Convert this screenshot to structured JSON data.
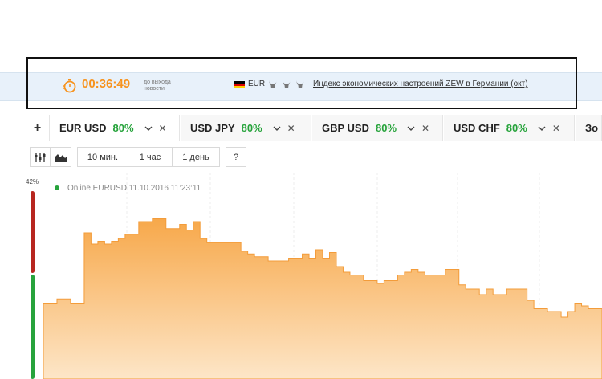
{
  "news": {
    "timer": "00:36:49",
    "caption": "до выхода новости",
    "currency": "EUR",
    "headline": "Индекс экономических настроений ZEW в Германии (окт)",
    "flag_colors": [
      "#000000",
      "#dd0000",
      "#ffce00"
    ],
    "accent_color": "#f7931e"
  },
  "tabs": {
    "add_label": "+",
    "items": [
      {
        "name": "EUR USD",
        "pct": "80%",
        "close": "✕",
        "active": true
      },
      {
        "name": "USD JPY",
        "pct": "80%",
        "close": "✕",
        "active": false
      },
      {
        "name": "GBP USD",
        "pct": "80%",
        "close": "✕",
        "active": false
      },
      {
        "name": "USD CHF",
        "pct": "80%",
        "close": "✕",
        "active": false
      },
      {
        "name": "Зо",
        "pct": "",
        "close": "",
        "active": false
      }
    ]
  },
  "toolbar": {
    "indicators_icon": "indicators-icon",
    "chart_type_icon": "area-chart-icon",
    "periods": [
      "10 мин.",
      "1 час",
      "1 день"
    ],
    "help": "?"
  },
  "sentiment": {
    "label": "42%",
    "down_color": "#b7261f",
    "up_color": "#27a33c"
  },
  "chart_data": {
    "type": "area",
    "status": "Online EURUSD 11.10.2016 11:23:11",
    "fill_color": "#f7a84a",
    "values": [
      0.3,
      0.3,
      0.33,
      0.33,
      0.3,
      0.3,
      0.8,
      0.72,
      0.74,
      0.72,
      0.74,
      0.76,
      0.79,
      0.79,
      0.88,
      0.88,
      0.9,
      0.9,
      0.83,
      0.83,
      0.86,
      0.82,
      0.88,
      0.76,
      0.73,
      0.73,
      0.73,
      0.73,
      0.73,
      0.67,
      0.65,
      0.63,
      0.63,
      0.6,
      0.6,
      0.6,
      0.62,
      0.62,
      0.65,
      0.62,
      0.68,
      0.62,
      0.66,
      0.56,
      0.52,
      0.5,
      0.5,
      0.46,
      0.46,
      0.44,
      0.46,
      0.46,
      0.5,
      0.52,
      0.54,
      0.52,
      0.5,
      0.5,
      0.5,
      0.54,
      0.54,
      0.43,
      0.4,
      0.4,
      0.36,
      0.4,
      0.36,
      0.36,
      0.4,
      0.4,
      0.4,
      0.32,
      0.26,
      0.26,
      0.24,
      0.24,
      0.2,
      0.24,
      0.3,
      0.28,
      0.26,
      0.26,
      0.22
    ],
    "ylim": [
      0,
      1
    ]
  }
}
